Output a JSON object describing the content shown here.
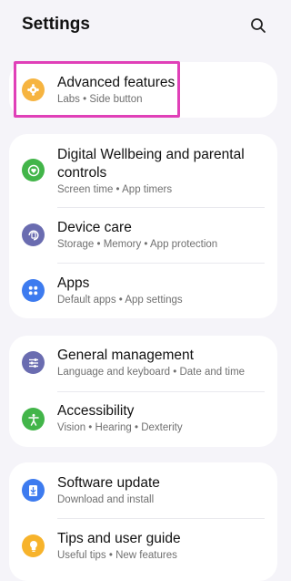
{
  "header": {
    "title": "Settings",
    "search_icon": "search-icon"
  },
  "colors": {
    "advanced": "#f6b440",
    "wellbeing": "#42b549",
    "device_care": "#6a6cb0",
    "apps": "#3d7bef",
    "general": "#6a6cb0",
    "accessibility": "#42b549",
    "software": "#3d7bef",
    "tips": "#f7b32b",
    "highlight": "#e040b8"
  },
  "groups": [
    {
      "items": [
        {
          "title": "Advanced features",
          "subtitle": "Labs • Side button",
          "icon": "star-gear-icon"
        }
      ]
    },
    {
      "items": [
        {
          "title": "Digital Wellbeing and parental controls",
          "subtitle": "Screen time • App timers",
          "icon": "heart-icon"
        },
        {
          "title": "Device care",
          "subtitle": "Storage • Memory • App protection",
          "icon": "device-care-icon"
        },
        {
          "title": "Apps",
          "subtitle": "Default apps • App settings",
          "icon": "apps-grid-icon"
        }
      ]
    },
    {
      "items": [
        {
          "title": "General management",
          "subtitle": "Language and keyboard • Date and time",
          "icon": "sliders-icon"
        },
        {
          "title": "Accessibility",
          "subtitle": "Vision • Hearing • Dexterity",
          "icon": "accessibility-person-icon"
        }
      ]
    },
    {
      "items": [
        {
          "title": "Software update",
          "subtitle": "Download and install",
          "icon": "download-icon"
        },
        {
          "title": "Tips and user guide",
          "subtitle": "Useful tips • New features",
          "icon": "lightbulb-icon"
        }
      ]
    }
  ]
}
